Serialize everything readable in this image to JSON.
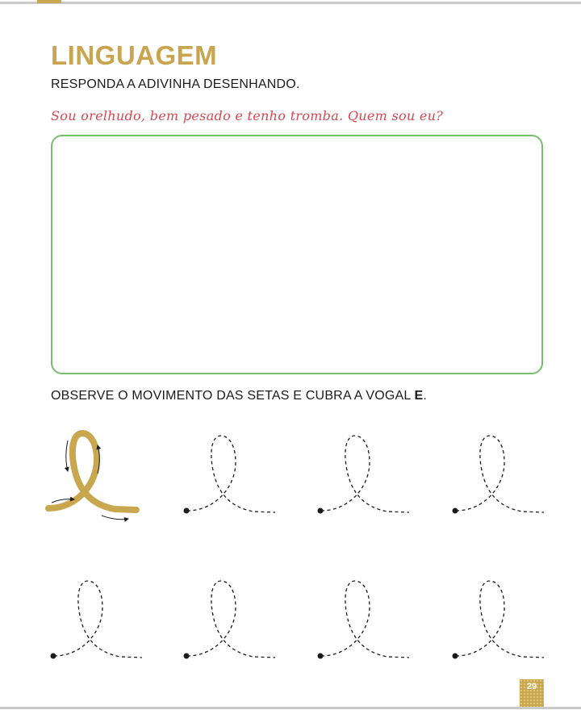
{
  "section": {
    "title": "LINGUAGEM"
  },
  "activity1": {
    "instruction": "RESPONDA A ADIVINHA DESENHANDO.",
    "riddle": "Sou orelhudo, bem pesado e tenho tromba. Quem sou eu?"
  },
  "activity2": {
    "instruction_prefix": "OBSERVE O MOVIMENTO DAS SETAS E CUBRA A VOGAL ",
    "instruction_letter": "E",
    "instruction_suffix": ".",
    "tracing_rows": [
      4,
      4
    ]
  },
  "page": {
    "number": "29"
  },
  "colors": {
    "title": "#c8a54e",
    "riddle": "#d8474f",
    "box_border": "#79bd6f",
    "model_letter": "#c9a74e",
    "badge": "#c9a74e"
  },
  "icons": {
    "model": "cursive-e-with-direction-arrows",
    "tracing": "dotted-cursive-e",
    "start": "start-point-dot"
  }
}
